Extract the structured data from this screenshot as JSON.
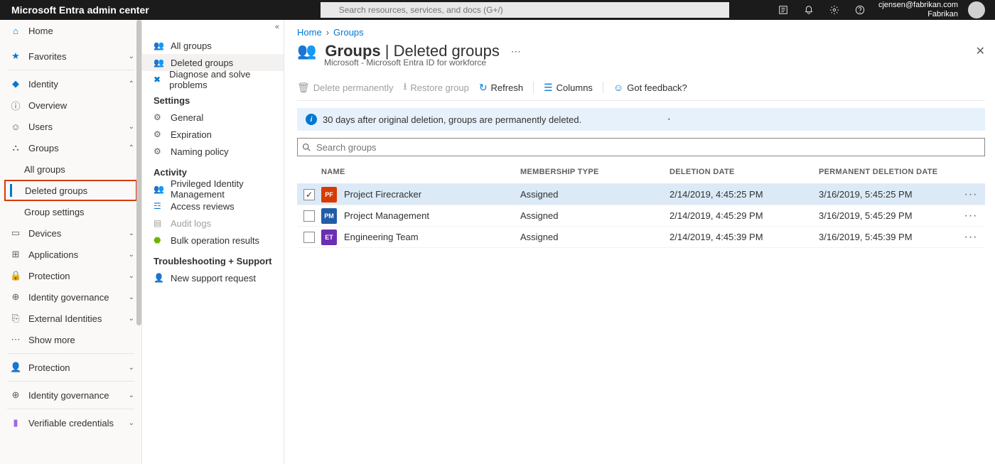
{
  "header": {
    "brand": "Microsoft Entra admin center",
    "search_placeholder": "Search resources, services, and docs (G+/)",
    "account_email": "cjensen@fabrikan.com",
    "account_org": "Fabrikan"
  },
  "nav1": {
    "home": "Home",
    "favorites": "Favorites",
    "identity": "Identity",
    "overview": "Overview",
    "users": "Users",
    "groups": "Groups",
    "all_groups": "All groups",
    "deleted_groups": "Deleted groups",
    "group_settings": "Group settings",
    "devices": "Devices",
    "applications": "Applications",
    "protection": "Protection",
    "identity_governance": "Identity governance",
    "external_identities": "External Identities",
    "show_more": "Show more",
    "protection2": "Protection",
    "identity_governance2": "Identity governance",
    "verifiable_credentials": "Verifiable credentials"
  },
  "nav2": {
    "all_groups": "All groups",
    "deleted_groups": "Deleted groups",
    "diagnose": "Diagnose and solve problems",
    "settings_hdr": "Settings",
    "general": "General",
    "expiration": "Expiration",
    "naming_policy": "Naming policy",
    "activity_hdr": "Activity",
    "pim": "Privileged Identity Management",
    "access_reviews": "Access reviews",
    "audit_logs": "Audit logs",
    "bulk_op": "Bulk operation results",
    "trouble_hdr": "Troubleshooting + Support",
    "new_support": "New support request"
  },
  "crumbs": {
    "home": "Home",
    "groups": "Groups"
  },
  "title": {
    "main": "Groups",
    "sub": "Deleted groups",
    "desc": "Microsoft - Microsoft Entra ID for workforce"
  },
  "cmds": {
    "delete_perm": "Delete permanently",
    "restore": "Restore group",
    "refresh": "Refresh",
    "columns": "Columns",
    "feedback": "Got feedback?"
  },
  "info": "30 days after original deletion, groups are permanently deleted.",
  "search_groups_placeholder": "Search groups",
  "columns": {
    "name": "NAME",
    "membership": "MEMBERSHIP TYPE",
    "deletion": "DELETION DATE",
    "permanent": "PERMANENT DELETION DATE"
  },
  "rows": [
    {
      "selected": true,
      "initials": "PF",
      "color": "#d83b01",
      "name": "Project Firecracker",
      "mt": "Assigned",
      "dd": "2/14/2019, 4:45:25 PM",
      "pd": "3/16/2019, 5:45:25 PM"
    },
    {
      "selected": false,
      "initials": "PM",
      "color": "#215ca6",
      "name": "Project Management",
      "mt": "Assigned",
      "dd": "2/14/2019, 4:45:29 PM",
      "pd": "3/16/2019, 5:45:29 PM"
    },
    {
      "selected": false,
      "initials": "ET",
      "color": "#6b2fb3",
      "name": "Engineering Team",
      "mt": "Assigned",
      "dd": "2/14/2019, 4:45:39 PM",
      "pd": "3/16/2019, 5:45:39 PM"
    }
  ]
}
